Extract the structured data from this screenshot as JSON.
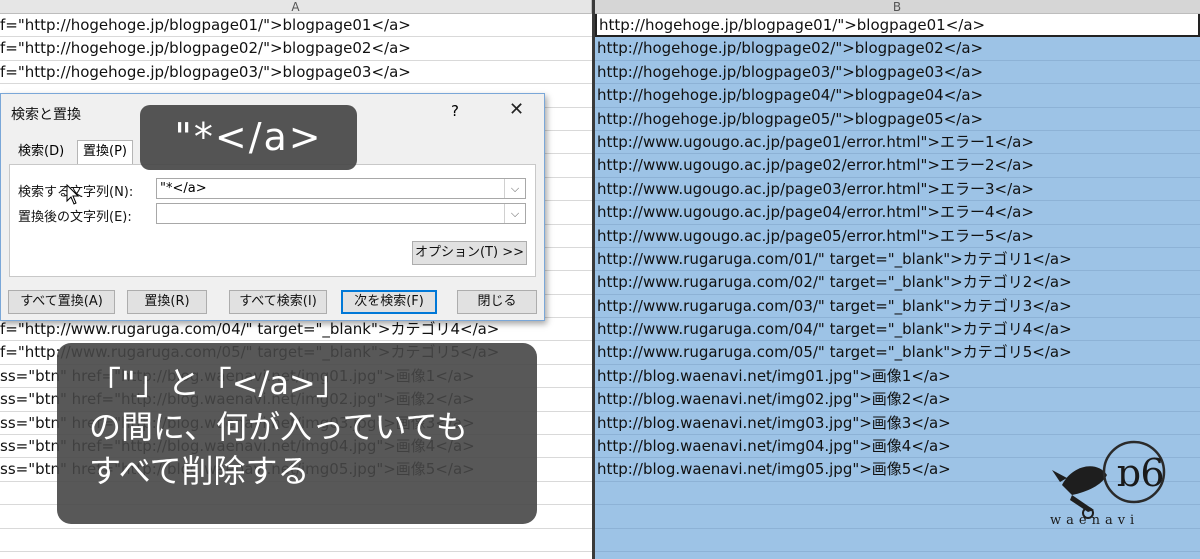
{
  "columns": {
    "a": "A",
    "b": "B"
  },
  "sheet_a_rows": [
    "f=\"http://hogehoge.jp/blogpage01/\">blogpage01</a>",
    "f=\"http://hogehoge.jp/blogpage02/\">blogpage02</a>",
    "f=\"http://hogehoge.jp/blogpage03/\">blogpage03</a>",
    "",
    "",
    "",
    "",
    "",
    "",
    "",
    "",
    "",
    "",
    "f=\"http://www.rugaruga.com/04/\"  target=\"_blank\">カテゴリ4</a>",
    "f=\"http://www.rugaruga.com/05/\"  target=\"_blank\">カテゴリ5</a>",
    "ss=\"btn\"  href=\"http://blog.waenavi.net/img01.jpg\">画像1</a>",
    "ss=\"btn\"  href=\"http://blog.waenavi.net/img02.jpg\">画像2</a>",
    "ss=\"btn\"  href=\"http://blog.waenavi.net/img03.jpg\">画像3</a>",
    "ss=\"btn\"  href=\"http://blog.waenavi.net/img04.jpg\">画像4</a>",
    "ss=\"btn\"  href=\"http://blog.waenavi.net/img05.jpg\">画像5</a>",
    "",
    "",
    ""
  ],
  "sheet_b_rows": [
    "http://hogehoge.jp/blogpage01/\">blogpage01</a>",
    "http://hogehoge.jp/blogpage02/\">blogpage02</a>",
    "http://hogehoge.jp/blogpage03/\">blogpage03</a>",
    "http://hogehoge.jp/blogpage04/\">blogpage04</a>",
    "http://hogehoge.jp/blogpage05/\">blogpage05</a>",
    "http://www.ugougo.ac.jp/page01/error.html\">エラー1</a>",
    "http://www.ugougo.ac.jp/page02/error.html\">エラー2</a>",
    "http://www.ugougo.ac.jp/page03/error.html\">エラー3</a>",
    "http://www.ugougo.ac.jp/page04/error.html\">エラー4</a>",
    "http://www.ugougo.ac.jp/page05/error.html\">エラー5</a>",
    "http://www.rugaruga.com/01/\"  target=\"_blank\">カテゴリ1</a>",
    "http://www.rugaruga.com/02/\"  target=\"_blank\">カテゴリ2</a>",
    "http://www.rugaruga.com/03/\"  target=\"_blank\">カテゴリ3</a>",
    "http://www.rugaruga.com/04/\"  target=\"_blank\">カテゴリ4</a>",
    "http://www.rugaruga.com/05/\"  target=\"_blank\">カテゴリ5</a>",
    "http://blog.waenavi.net/img01.jpg\">画像1</a>",
    "http://blog.waenavi.net/img02.jpg\">画像2</a>",
    "http://blog.waenavi.net/img03.jpg\">画像3</a>",
    "http://blog.waenavi.net/img04.jpg\">画像4</a>",
    "http://blog.waenavi.net/img05.jpg\">画像5</a>",
    "",
    "",
    "",
    ""
  ],
  "dialog": {
    "title": "検索と置換",
    "help": "?",
    "close": "✕",
    "tab_search": "検索(D)",
    "tab_replace": "置換(P)",
    "find_label": "検索する文字列(N):",
    "find_value": "\"*</a>",
    "replace_label": "置換後の文字列(E):",
    "replace_value": "",
    "options_button": "オプション(T) >>",
    "replace_all": "すべて置換(A)",
    "replace": "置換(R)",
    "find_all": "すべて検索(I)",
    "find_next": "次を検索(F)",
    "close_button": "閉じる"
  },
  "overlay_small": "\"*</a>",
  "overlay_big": {
    "line1": "「\"」と「</a>」",
    "line2": "の間に、何が入っていても",
    "line3": "すべて削除する"
  },
  "logo_text": "waenavi"
}
